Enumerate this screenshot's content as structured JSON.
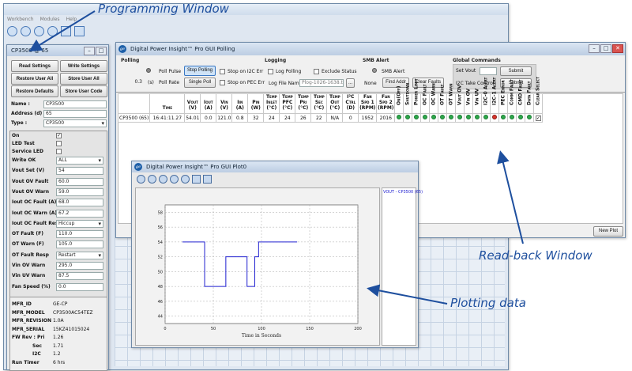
{
  "workbench": {
    "menu": [
      "Workbench",
      "Modules",
      "Help"
    ]
  },
  "prog": {
    "title": "CP3500 @ 65",
    "buttons": [
      "Read Settings",
      "Write Settings",
      "Restore User All",
      "Store User All",
      "Restore Defaults",
      "Store User Code"
    ],
    "name_label": "Name :",
    "name_value": "CP3500",
    "address_label": "Address (d) :",
    "address_value": "65",
    "type_label": "Type :",
    "type_value": "CP3500",
    "checks": [
      {
        "label": "On",
        "checked": true
      },
      {
        "label": "LED Test",
        "checked": false
      },
      {
        "label": "Service LED",
        "checked": false
      }
    ],
    "fields": [
      {
        "label": "Write OK",
        "value": "ALL",
        "dropdown": true
      },
      {
        "label": "Vout Set (V)",
        "value": "54"
      },
      {
        "label": "Vout OV Fault",
        "value": "60.0"
      },
      {
        "label": "Vout OV Warn",
        "value": "59.0"
      },
      {
        "label": "Iout OC Fault (A)",
        "value": "68.0"
      },
      {
        "label": "Iout OC Warn (A)",
        "value": "67.2"
      },
      {
        "label": "Iout OC Fault Resp",
        "value": "Hiccup",
        "dropdown": true
      },
      {
        "label": "OT Fault (F)",
        "value": "110.0"
      },
      {
        "label": "OT Warn (F)",
        "value": "105.0"
      },
      {
        "label": "OT Fault Resp",
        "value": "Restart",
        "dropdown": true
      },
      {
        "label": "Vin OV Warn",
        "value": "295.0"
      },
      {
        "label": "Vin UV Warn",
        "value": "87.5"
      },
      {
        "label": "Fan Speed (%)",
        "value": "0.0"
      }
    ],
    "mfr": [
      {
        "label": "MFR_ID",
        "value": "GE-CP"
      },
      {
        "label": "MFR_MODEL",
        "value": "CP3500AC54TEZ"
      },
      {
        "label": "MFR_REVISION",
        "value": "1.0A"
      },
      {
        "label": "MFR_SERIAL",
        "value": "15KZ41015024"
      },
      {
        "label": "FW Rev : Pri",
        "value": "1.26"
      },
      {
        "label": "Sec",
        "value": "1.71"
      },
      {
        "label": "I2C",
        "value": "1.2"
      },
      {
        "label": "Run Timer",
        "value": "6 hrs"
      }
    ]
  },
  "polling": {
    "title": "Digital Power Insight™ Pro GUI Polling",
    "group_polling": "Polling",
    "poll_pulse": "Poll Pulse",
    "stop_polling": "Stop Polling",
    "interval_value": "0.3",
    "interval_unit": "(s)",
    "poll_rate": "Poll Rate",
    "single_poll": "Single Poll",
    "stop_i2c": "Stop on I2C Err",
    "stop_pec": "Stop on PEC Err",
    "group_logging": "Logging",
    "log_polling": "Log Polling",
    "exclude_status": "Exclude Status",
    "log_file_label": "Log File Name",
    "log_file_value": "Plog-1026-1638.txt",
    "browse": "...",
    "group_smb": "SMB Alert",
    "smb_alert": "SMB Alert",
    "smb_none": "None",
    "find_addr": "Find Addr",
    "clear_faults": "Clear Faults",
    "group_global": "Global Commands",
    "set_vout": "Set Vout",
    "submit1": "Submit",
    "i2c_take": "I2C Take Control",
    "submit2": "Submit",
    "new_plot": "New Plot",
    "columns": [
      [
        "Time"
      ],
      [
        "Vout",
        "(V)"
      ],
      [
        "Iout",
        "(A)"
      ],
      [
        "Vin",
        "(V)"
      ],
      [
        "Iin",
        "(A)"
      ],
      [
        "Pin",
        "(W)"
      ],
      [
        "Temp",
        "Inlet",
        "(°C)"
      ],
      [
        "Temp",
        "PFC",
        "(°C)"
      ],
      [
        "Temp",
        "Pri",
        "(°C)"
      ],
      [
        "Temp",
        "Sec",
        "(°C)"
      ],
      [
        "Temp",
        "Out",
        "(°C)"
      ],
      [
        "I²C",
        "Ctrl",
        "(D)"
      ],
      [
        "Fan",
        "Spd 1",
        "(RPM)"
      ],
      [
        "Fan",
        "Spd 2",
        "(RPM)"
      ]
    ],
    "status_columns": [
      "On(Off)",
      "Shutdown",
      "Power Limit",
      "OC Fault",
      "OC Warn",
      "OT Fault",
      "OT Warn",
      "Vout OV",
      "Vin OV",
      "Vin UV",
      "I2C-0 Alert",
      "I2C-1 Alert",
      "PEC Error",
      "Comm Fault",
      "CMD Fault",
      "Data Fault",
      "Clear Select"
    ],
    "row": {
      "device": "CP3500 (65)",
      "values": [
        "16:41:11.27",
        "54.01",
        "0.0",
        "121.0",
        "0.8",
        "32",
        "24",
        "24",
        "26",
        "22",
        "N/A",
        "0",
        "1952",
        "2016"
      ],
      "status": [
        "green",
        "green",
        "green",
        "green",
        "green",
        "green",
        "green",
        "green",
        "green",
        "green",
        "green",
        "red",
        "green",
        "green",
        "green",
        "green",
        "check"
      ]
    }
  },
  "plot": {
    "title": "Digital Power Insight™ Pro GUI Plot0",
    "legend": "VOUT - CP3500 (65)",
    "xlabel": "Time in Seconds",
    "toolbar_icons": [
      "home-icon",
      "back-icon",
      "forward-icon",
      "pan-icon",
      "zoom-icon",
      "configure-icon",
      "save-icon"
    ]
  },
  "chart_data": {
    "type": "line",
    "title": "",
    "xlabel": "Time in Seconds",
    "ylabel": "",
    "xlim": [
      0,
      200
    ],
    "ylim": [
      43,
      59
    ],
    "xticks": [
      0,
      50,
      100,
      150,
      200
    ],
    "yticks": [
      44,
      46,
      48,
      50,
      52,
      54,
      56,
      58
    ],
    "grid": true,
    "series": [
      {
        "name": "VOUT - CP3500 (65)",
        "color": "#2020d0",
        "x": [
          18,
          41,
          41,
          63,
          63,
          85,
          85,
          93,
          93,
          97,
          97,
          113,
          113,
          137
        ],
        "y": [
          54,
          54,
          48,
          48,
          52,
          52,
          48,
          48,
          52,
          52,
          54,
          54,
          54,
          54
        ]
      }
    ]
  },
  "annotations": {
    "programming": "Programming Window",
    "readback": "Read-back Window",
    "plotting": "Plotting data"
  }
}
